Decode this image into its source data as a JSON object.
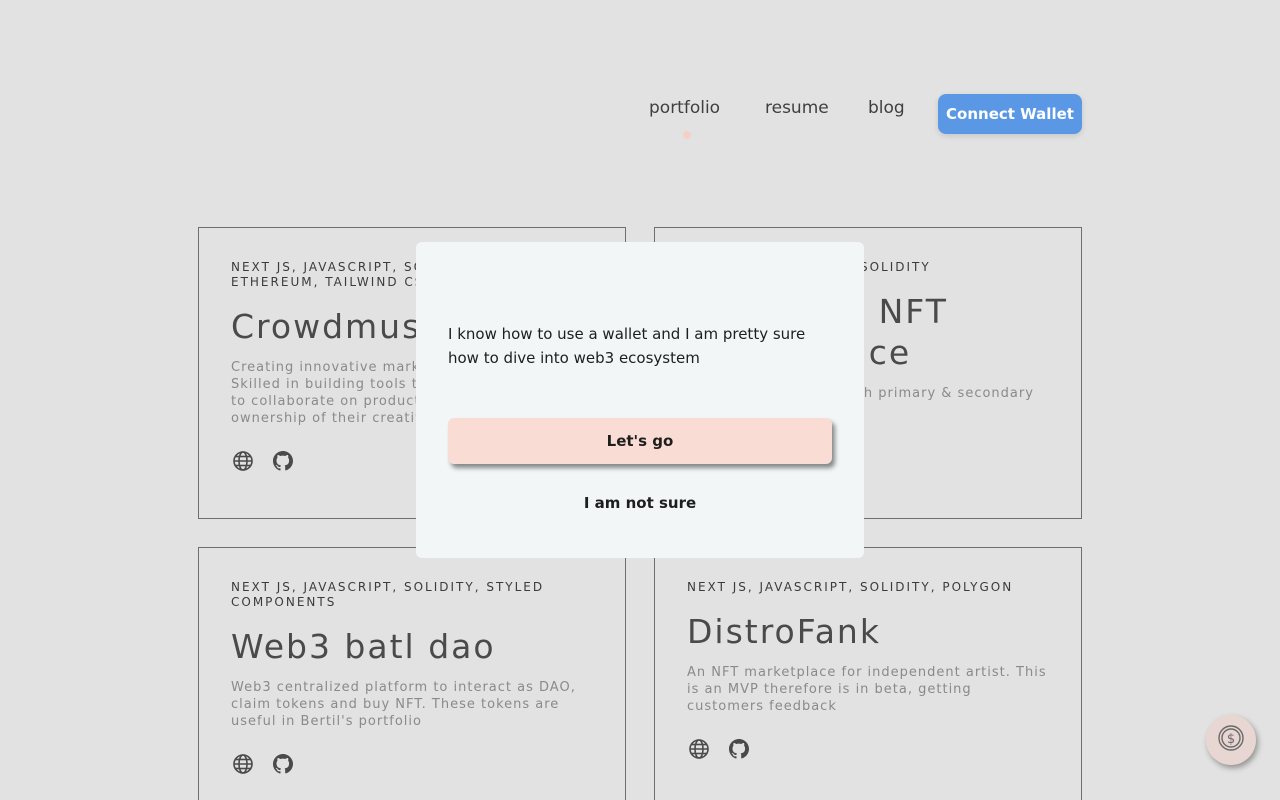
{
  "nav": {
    "links": [
      "portfolio",
      "resume",
      "blog"
    ],
    "connect_label": "Connect Wallet"
  },
  "cards": [
    {
      "tags": "NEXT JS, JAVASCRIPT, SOLIDITY, ETHEREUM, TAILWIND CSS",
      "title": "Crowdmuse",
      "desc": "Creating innovative marketplace products. Skilled in building tools that empower creators to collaborate on products, while retaining ownership of their creative assets."
    },
    {
      "tags": "NEXT JS, JAVASCRIPT, SOLIDITY",
      "title": "Multilevel NFT Marketplace",
      "desc": "An NFT marketplace with primary & secondary sales as B2B"
    },
    {
      "tags": "NEXT JS, JAVASCRIPT, SOLIDITY, STYLED COMPONENTS",
      "title": "Web3 batl dao",
      "desc": "Web3 centralized platform to interact as DAO, claim tokens and buy NFT. These tokens are useful in Bertil's portfolio"
    },
    {
      "tags": "NEXT JS, JAVASCRIPT, SOLIDITY, POLYGON",
      "title": "DistroFank",
      "desc": "An NFT marketplace for independent artist. This is an MVP therefore is in beta, getting customers feedback"
    }
  ],
  "modal": {
    "text": "I know how to use a wallet and I am pretty sure how to dive into web3 ecosystem",
    "go_label": "Let's go",
    "notsure_label": "I am not sure"
  },
  "colors": {
    "background": "#e1e2e1",
    "accent": "#5a98e6",
    "primary_button": "#f9dcd3"
  }
}
